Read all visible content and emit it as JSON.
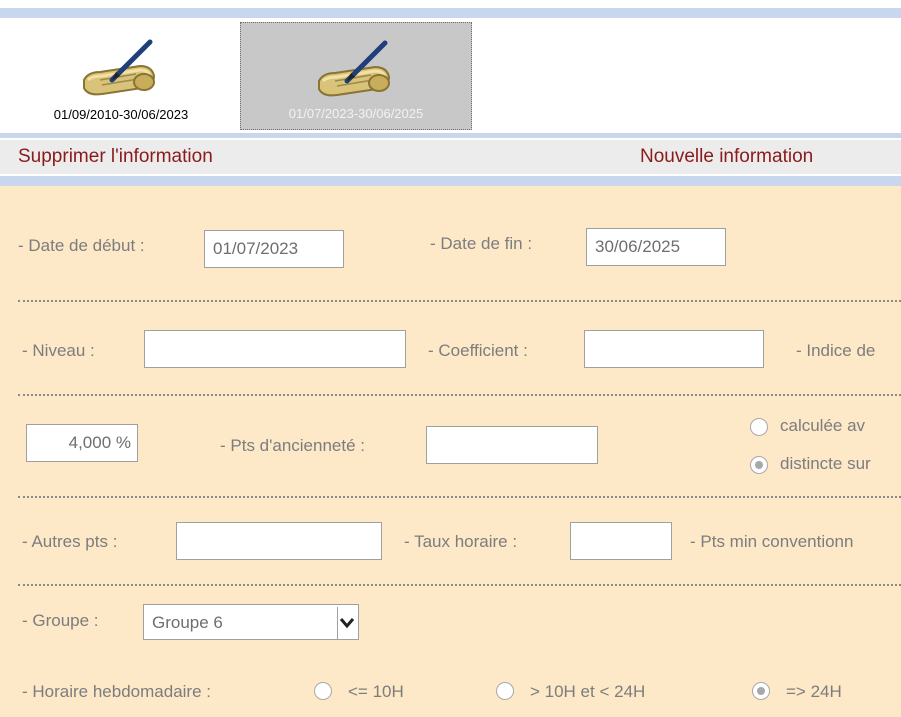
{
  "tabs": [
    {
      "label": "01/09/2010-30/06/2023",
      "icon": "contract-scroll-pen-icon"
    },
    {
      "label": "01/07/2023-30/06/2025",
      "icon": "contract-scroll-pen-icon"
    }
  ],
  "actions": {
    "delete": "Supprimer l'information",
    "new": "Nouvelle information"
  },
  "form": {
    "date_debut_label": "- Date de début :",
    "date_debut_value": "01/07/2023",
    "date_fin_label": "- Date de fin :",
    "date_fin_value": "30/06/2025",
    "niveau_label": "- Niveau :",
    "niveau_value": "",
    "coefficient_label": "- Coefficient  :",
    "coefficient_value": "",
    "indice_label": "- Indice de",
    "percent_value": "4,000 %",
    "pts_anciennete_label": "- Pts d'ancienneté :",
    "pts_anciennete_value": "",
    "radio_calculee_label": "calculée av",
    "radio_distincte_label": "distincte sur",
    "autres_pts_label": "- Autres pts :",
    "autres_pts_value": "",
    "taux_horaire_label": "- Taux horaire :",
    "taux_horaire_value": "",
    "pts_min_label": "- Pts min conventionn",
    "groupe_label": "- Groupe :",
    "groupe_value": "Groupe 6",
    "horaire_label": "- Horaire hebdomadaire :",
    "horaire_options": [
      "<= 10H",
      "> 10H et < 24H",
      "=> 24H"
    ],
    "horaire_selected": "=> 24H"
  },
  "colors": {
    "form_background": "#fde8c8",
    "action_text": "#8b1a1a",
    "band": "#c9d7ee",
    "selected_tab": "#c8c8c8"
  }
}
